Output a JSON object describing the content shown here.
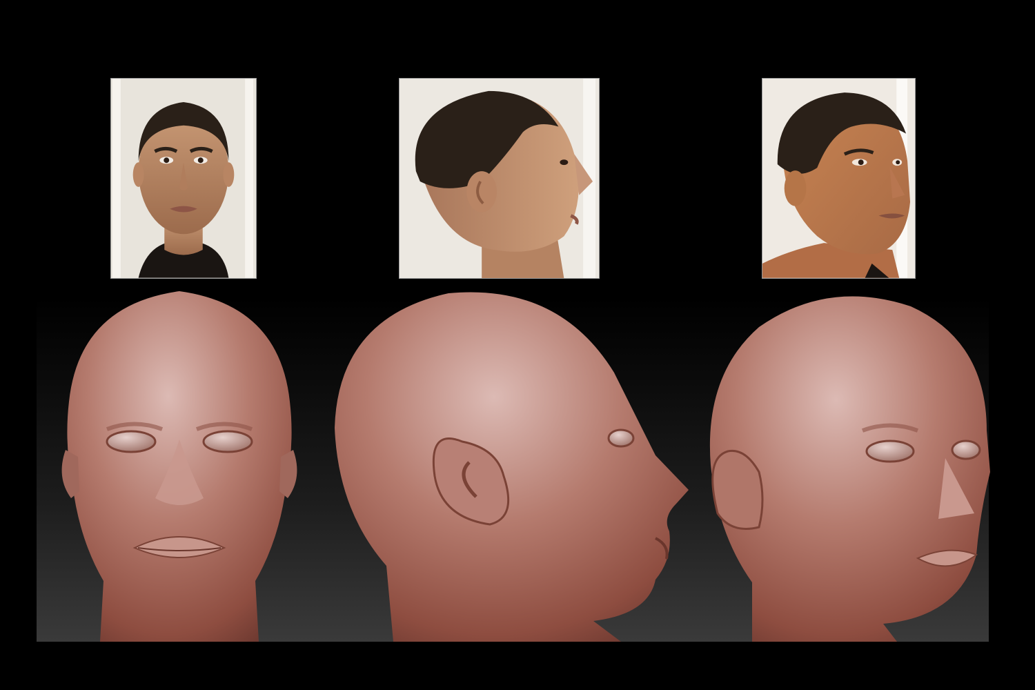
{
  "figure": {
    "reference_photos": [
      {
        "view": "front",
        "icon": "portrait-front"
      },
      {
        "view": "profile-right",
        "icon": "portrait-profile"
      },
      {
        "view": "three-quarter-right",
        "icon": "portrait-three-quarter"
      }
    ],
    "sculpt_renders": [
      {
        "view": "front",
        "icon": "clay-head-front"
      },
      {
        "view": "profile-right",
        "icon": "clay-head-profile"
      },
      {
        "view": "three-quarter-right",
        "icon": "clay-head-three-quarter"
      }
    ],
    "colors": {
      "background": "#000000",
      "photo_backdrop": "#e7e3dc",
      "skin": "#c08a66",
      "hair": "#2a2018",
      "clay": "#a8665a",
      "clay_highlight": "#d9b4ae"
    }
  }
}
